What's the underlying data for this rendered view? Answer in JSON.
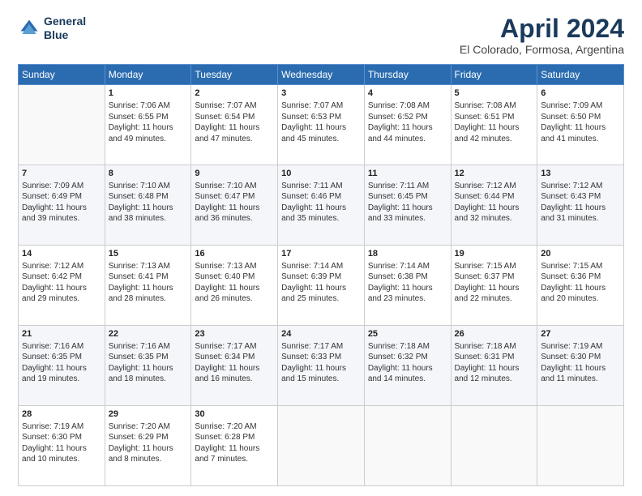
{
  "header": {
    "logo_line1": "General",
    "logo_line2": "Blue",
    "title": "April 2024",
    "subtitle": "El Colorado, Formosa, Argentina"
  },
  "days_of_week": [
    "Sunday",
    "Monday",
    "Tuesday",
    "Wednesday",
    "Thursday",
    "Friday",
    "Saturday"
  ],
  "weeks": [
    [
      {
        "day": "",
        "info": ""
      },
      {
        "day": "1",
        "info": "Sunrise: 7:06 AM\nSunset: 6:55 PM\nDaylight: 11 hours\nand 49 minutes."
      },
      {
        "day": "2",
        "info": "Sunrise: 7:07 AM\nSunset: 6:54 PM\nDaylight: 11 hours\nand 47 minutes."
      },
      {
        "day": "3",
        "info": "Sunrise: 7:07 AM\nSunset: 6:53 PM\nDaylight: 11 hours\nand 45 minutes."
      },
      {
        "day": "4",
        "info": "Sunrise: 7:08 AM\nSunset: 6:52 PM\nDaylight: 11 hours\nand 44 minutes."
      },
      {
        "day": "5",
        "info": "Sunrise: 7:08 AM\nSunset: 6:51 PM\nDaylight: 11 hours\nand 42 minutes."
      },
      {
        "day": "6",
        "info": "Sunrise: 7:09 AM\nSunset: 6:50 PM\nDaylight: 11 hours\nand 41 minutes."
      }
    ],
    [
      {
        "day": "7",
        "info": "Sunrise: 7:09 AM\nSunset: 6:49 PM\nDaylight: 11 hours\nand 39 minutes."
      },
      {
        "day": "8",
        "info": "Sunrise: 7:10 AM\nSunset: 6:48 PM\nDaylight: 11 hours\nand 38 minutes."
      },
      {
        "day": "9",
        "info": "Sunrise: 7:10 AM\nSunset: 6:47 PM\nDaylight: 11 hours\nand 36 minutes."
      },
      {
        "day": "10",
        "info": "Sunrise: 7:11 AM\nSunset: 6:46 PM\nDaylight: 11 hours\nand 35 minutes."
      },
      {
        "day": "11",
        "info": "Sunrise: 7:11 AM\nSunset: 6:45 PM\nDaylight: 11 hours\nand 33 minutes."
      },
      {
        "day": "12",
        "info": "Sunrise: 7:12 AM\nSunset: 6:44 PM\nDaylight: 11 hours\nand 32 minutes."
      },
      {
        "day": "13",
        "info": "Sunrise: 7:12 AM\nSunset: 6:43 PM\nDaylight: 11 hours\nand 31 minutes."
      }
    ],
    [
      {
        "day": "14",
        "info": "Sunrise: 7:12 AM\nSunset: 6:42 PM\nDaylight: 11 hours\nand 29 minutes."
      },
      {
        "day": "15",
        "info": "Sunrise: 7:13 AM\nSunset: 6:41 PM\nDaylight: 11 hours\nand 28 minutes."
      },
      {
        "day": "16",
        "info": "Sunrise: 7:13 AM\nSunset: 6:40 PM\nDaylight: 11 hours\nand 26 minutes."
      },
      {
        "day": "17",
        "info": "Sunrise: 7:14 AM\nSunset: 6:39 PM\nDaylight: 11 hours\nand 25 minutes."
      },
      {
        "day": "18",
        "info": "Sunrise: 7:14 AM\nSunset: 6:38 PM\nDaylight: 11 hours\nand 23 minutes."
      },
      {
        "day": "19",
        "info": "Sunrise: 7:15 AM\nSunset: 6:37 PM\nDaylight: 11 hours\nand 22 minutes."
      },
      {
        "day": "20",
        "info": "Sunrise: 7:15 AM\nSunset: 6:36 PM\nDaylight: 11 hours\nand 20 minutes."
      }
    ],
    [
      {
        "day": "21",
        "info": "Sunrise: 7:16 AM\nSunset: 6:35 PM\nDaylight: 11 hours\nand 19 minutes."
      },
      {
        "day": "22",
        "info": "Sunrise: 7:16 AM\nSunset: 6:35 PM\nDaylight: 11 hours\nand 18 minutes."
      },
      {
        "day": "23",
        "info": "Sunrise: 7:17 AM\nSunset: 6:34 PM\nDaylight: 11 hours\nand 16 minutes."
      },
      {
        "day": "24",
        "info": "Sunrise: 7:17 AM\nSunset: 6:33 PM\nDaylight: 11 hours\nand 15 minutes."
      },
      {
        "day": "25",
        "info": "Sunrise: 7:18 AM\nSunset: 6:32 PM\nDaylight: 11 hours\nand 14 minutes."
      },
      {
        "day": "26",
        "info": "Sunrise: 7:18 AM\nSunset: 6:31 PM\nDaylight: 11 hours\nand 12 minutes."
      },
      {
        "day": "27",
        "info": "Sunrise: 7:19 AM\nSunset: 6:30 PM\nDaylight: 11 hours\nand 11 minutes."
      }
    ],
    [
      {
        "day": "28",
        "info": "Sunrise: 7:19 AM\nSunset: 6:30 PM\nDaylight: 11 hours\nand 10 minutes."
      },
      {
        "day": "29",
        "info": "Sunrise: 7:20 AM\nSunset: 6:29 PM\nDaylight: 11 hours\nand 8 minutes."
      },
      {
        "day": "30",
        "info": "Sunrise: 7:20 AM\nSunset: 6:28 PM\nDaylight: 11 hours\nand 7 minutes."
      },
      {
        "day": "",
        "info": ""
      },
      {
        "day": "",
        "info": ""
      },
      {
        "day": "",
        "info": ""
      },
      {
        "day": "",
        "info": ""
      }
    ]
  ]
}
